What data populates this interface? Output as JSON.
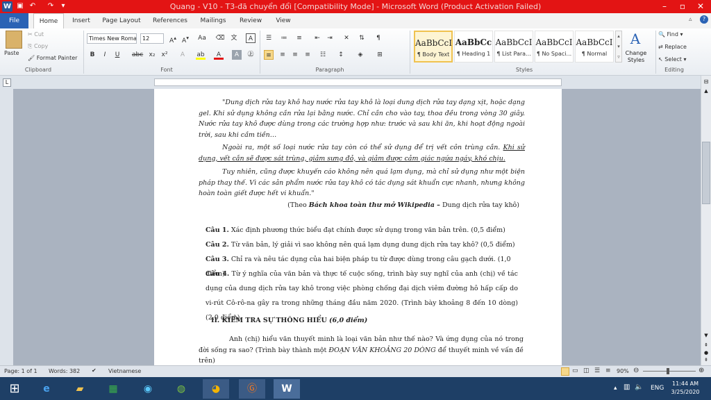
{
  "titlebar": {
    "title": "Quang - V10 - T3-đã chuyển đổi [Compatibility Mode] - Microsoft Word (Product Activation Failed)"
  },
  "tabs": [
    "File",
    "Home",
    "Insert",
    "Page Layout",
    "References",
    "Mailings",
    "Review",
    "View"
  ],
  "clipboard": {
    "paste": "Paste",
    "cut": "Cut",
    "copy": "Copy",
    "format_painter": "Format Painter",
    "group": "Clipboard"
  },
  "font": {
    "name": "Times New Roma",
    "size": "12",
    "group": "Font"
  },
  "paragraph": {
    "group": "Paragraph"
  },
  "styles": {
    "items": [
      {
        "sample": "AaBbCcI",
        "name": "¶ Body Text"
      },
      {
        "sample": "AaBbCc",
        "name": "¶ Heading 1"
      },
      {
        "sample": "AaBbCcI",
        "name": "¶ List Para..."
      },
      {
        "sample": "AaBbCcI",
        "name": "¶ No Spaci..."
      },
      {
        "sample": "AaBbCcI",
        "name": "¶ Normal"
      }
    ],
    "change": "Change Styles",
    "group": "Styles"
  },
  "editing": {
    "find": "Find",
    "replace": "Replace",
    "select": "Select",
    "group": "Editing"
  },
  "doc": {
    "quote1": "\"Dung dịch rửa tay khô hay nước rửa tay khô là loại dung dịch rửa tay dạng xịt, hoặc dạng gel. Khi sử dụng không cần rửa lại bằng nước. Chỉ cần cho vào tay, thoa đều trong vòng 30 giây. Nước rửa tay khô được dùng trong các trường hợp như: trước và sau khi ăn, khi hoạt động ngoài trời, sau khi cầm tiền…",
    "quote2a": "Ngoài ra, một số loại nước rửa tay còn có thể sử dụng để trị vết côn trùng cắn.",
    "quote2b": "Khi sử dụng, vết cắn sẽ được sát trùng, giảm sưng đỏ, và giảm được cảm giác ngứa ngáy, khó chịu.",
    "quote3": "Tuy nhiên, cũng được khuyến cáo không nên quá lạm dụng, mà chỉ sử dụng như một biện pháp thay thế. Vì các sản phẩm nước rửa tay khô có tác dụng sát khuẩn cực nhanh, nhưng không hoàn toàn giết được hết vi khuẩn.\"",
    "source_pre": "(Theo ",
    "source_bold": "Bách khoa toàn thư mở Wikipedia –",
    "source_post": " Dung dịch rửa tay khô)",
    "q1_label": "Câu 1.",
    "q1": " Xác định phương thức biểu đạt chính được sử dụng trong văn bản trên. (0,5 điểm)",
    "q2_label": "Câu 2.",
    "q2": " Từ văn bản, lý giải vì sao không nên quá lạm dụng dung dịch rửa tay khô? (0,5 điểm)",
    "q3_label": "Câu 3.",
    "q3": " Chỉ ra và nêu tác dụng của hai biện pháp tu từ được dùng trong câu gạch dưới. (1,0 điểm)",
    "q4_label": "Câu 4.",
    "q4": " Từ ý nghĩa của văn bản và thực tế cuộc sống, trình bày suy nghĩ của anh (chị) về tác dụng của dung dịch rửa tay khô trong việc phòng chống đại dịch viêm đường hô hấp cấp do vi-rút Cô-rô-na gây ra trong những tháng đầu năm 2020. (Trình bày khoảng 8 đến 10 dòng) (2,0 điểm)",
    "section": "II. KIỂM TRA SỰ THÔNG HIỂU",
    "section_pts": "(6,0 điểm)",
    "essay_a": "Anh (chị) hiểu văn thuyết minh là loại văn bản như thế nào? Và ứng dụng của nó trong đời sống ra sao? (Trình bày thành một ",
    "essay_i": "ĐOẠN VĂN KHOẢNG 20 DÒNG",
    "essay_b": " để thuyết minh về vấn đề trên)"
  },
  "status": {
    "page": "Page: 1 of 1",
    "words": "Words: 382",
    "lang": "Vietnamese",
    "zoom": "90%"
  },
  "taskbar": {
    "time": "11:44 AM",
    "date": "3/25/2020",
    "lang": "ENG"
  }
}
